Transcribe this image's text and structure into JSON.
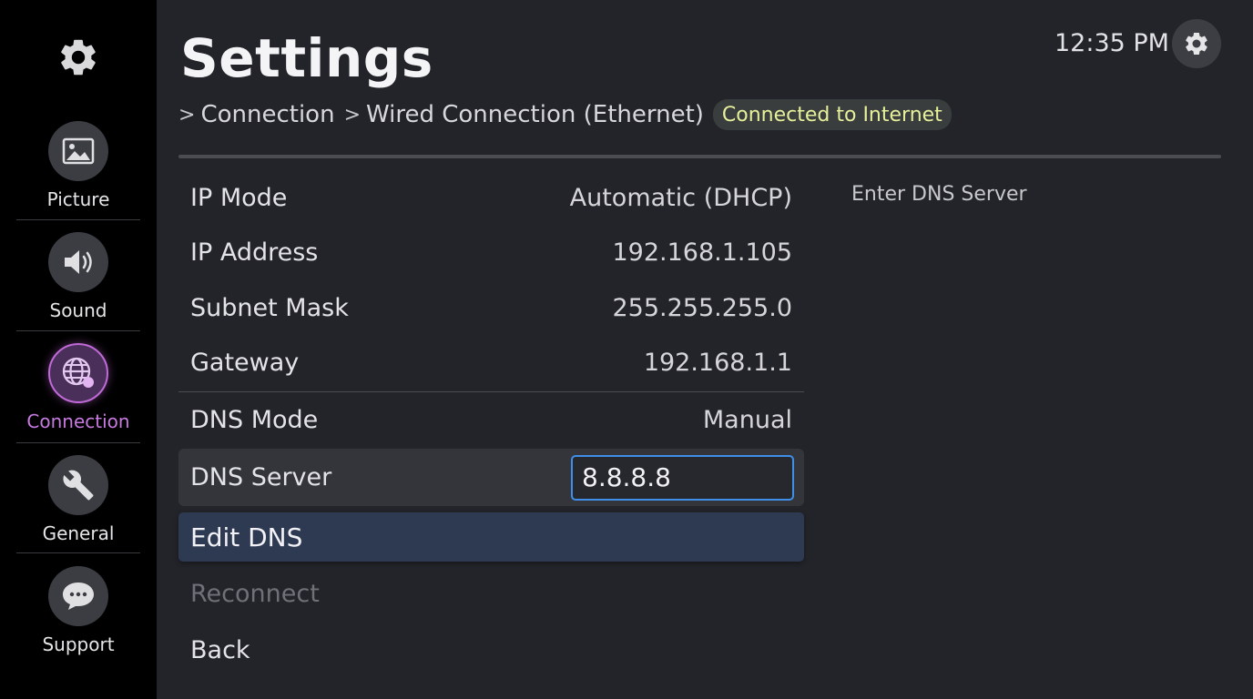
{
  "header": {
    "title": "Settings",
    "breadcrumb": [
      "Connection",
      "Wired Connection (Ethernet)"
    ],
    "breadcrumb_separator": ">",
    "status_badge": "Connected to Internet",
    "clock": "12:35 PM"
  },
  "sidebar": {
    "items": [
      {
        "label": "Picture",
        "icon": "picture-icon",
        "active": false
      },
      {
        "label": "Sound",
        "icon": "speaker-icon",
        "active": false
      },
      {
        "label": "Connection",
        "icon": "globe-icon",
        "active": true
      },
      {
        "label": "General",
        "icon": "wrench-icon",
        "active": false
      },
      {
        "label": "Support",
        "icon": "chat-bubble-icon",
        "active": false
      }
    ]
  },
  "settings": {
    "ip_mode": {
      "label": "IP Mode",
      "value": "Automatic (DHCP)"
    },
    "ip_address": {
      "label": "IP Address",
      "value": "192.168.1.105"
    },
    "subnet_mask": {
      "label": "Subnet Mask",
      "value": "255.255.255.0"
    },
    "gateway": {
      "label": "Gateway",
      "value": "192.168.1.1"
    },
    "dns_mode": {
      "label": "DNS Mode",
      "value": "Manual"
    },
    "dns_server": {
      "label": "DNS Server",
      "value": "8.8.8.8"
    },
    "edit_dns": "Edit DNS",
    "reconnect": "Reconnect",
    "back": "Back"
  },
  "hint": "Enter DNS Server",
  "colors": {
    "accent_purple": "#c06ad8",
    "focus_blue": "#3f8fe8",
    "badge_text": "#e6ef9a",
    "selected_row": "#2d3a52"
  }
}
